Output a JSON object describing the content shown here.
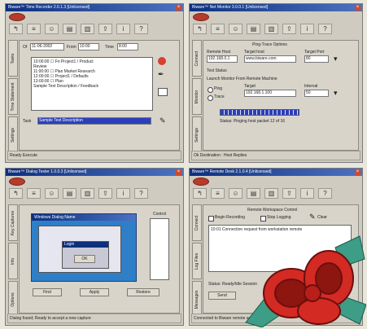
{
  "w1": {
    "title": "Biware™ Time Recorder 2.0.1.3 [Unlicensed]",
    "tabs": [
      "Tasks",
      "Time Statement",
      "Settings"
    ],
    "date_label": "Of",
    "date_value": "11-06-2002",
    "from_label": "From",
    "from_value": "10:00",
    "time_label": "Time",
    "time_value": "8:00",
    "log": [
      "10:00:00  ☐ Fri  Project1 / Product",
      "Review",
      "11:00:00  ☐ Plan  Market Research",
      "12:00:00  ☐ Project1 / Defaults",
      "13:00:00  ☐ Plan",
      "Sample Text Description / Feedback"
    ],
    "task_label": "Task",
    "task_value": "Sample Text Description",
    "status": "Ready Execute"
  },
  "w2": {
    "title": "Biware™ Net Monitor 3.0.0.1 [Unlicensed]",
    "tabs": [
      "Connect",
      "Monitor",
      "Settings"
    ],
    "group_title": "Ping-Trace Options",
    "host_label": "Remote Host",
    "host_value": "192.168.0.1",
    "target_label": "Target host",
    "target_value": "www.biware.com",
    "port_label": "Target Port",
    "port_value": "80",
    "test_label": "Test Status",
    "launch_label": "Launch Monitor From Remote Machine",
    "target2_label": "Target",
    "target2_value": "192.168.1.100",
    "count_label": "Interval",
    "count_value": "50",
    "opt1": "Ping",
    "opt2": "Trace",
    "progress_fraction": 0.75,
    "status_line": "Status: Pinging host packet 12 of 16",
    "status": "Ok   Destination : Host Replies"
  },
  "w3": {
    "title": "Biware™ Dialog Tester 1.0.0.3 [Unlicensed]",
    "tabs": [
      "Key Captures",
      "Info",
      "Options"
    ],
    "dialog_title": "Windows Dialog Name",
    "inner_title": "Login",
    "ok_label": "OK",
    "list_title": "Control",
    "btn1": "Find",
    "btn2": "Apply",
    "btn3": "Restore",
    "status": "Dialog found; Ready to accept a new capture"
  },
  "w4": {
    "title": "Biware™ Remote Desk 2.1.0.4 [Unlicensed]",
    "tabs": [
      "Connect",
      "Log Files",
      "Messages"
    ],
    "heading": "Remote Workspace Control",
    "opt1": "Begin Recording",
    "opt2": "Stop Logging",
    "opt3": "Clear",
    "log_text": "10:01  Connection request from workstation  remote",
    "status_label": "Status: Ready/Idle Session",
    "send_label": "Send",
    "status": "Connected to Biware remote session"
  },
  "colors": {
    "titlebar": "#0c2f7e",
    "accent": "#2c3fbb",
    "ribbon": "#d42a24"
  },
  "icons": [
    "logo-icon",
    "back-icon",
    "tasks-icon",
    "user-icon",
    "report-icon",
    "chart-icon",
    "export-icon",
    "info-icon",
    "help-icon",
    "record-icon",
    "stopwatch-icon",
    "pencil-icon",
    "ribbon-bow-icon"
  ]
}
